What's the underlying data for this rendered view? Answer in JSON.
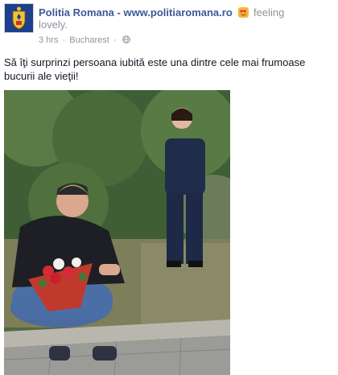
{
  "post": {
    "page_name": "Politia Romana - www.politiaromana.ro",
    "feeling_label": "feeling",
    "feeling_value": "lovely.",
    "time": "3 hrs",
    "separator": "·",
    "location": "Bucharest",
    "privacy_icon": "globe-icon",
    "feeling_icon": "smiley-heart-eyes-icon",
    "message": "Să îţi surprinzi persoana iubită este una dintre cele mai frumoase bucurii ale vieţii!"
  },
  "colors": {
    "link_blue": "#3b5998",
    "meta_gray": "#90949c",
    "text": "#141823"
  }
}
